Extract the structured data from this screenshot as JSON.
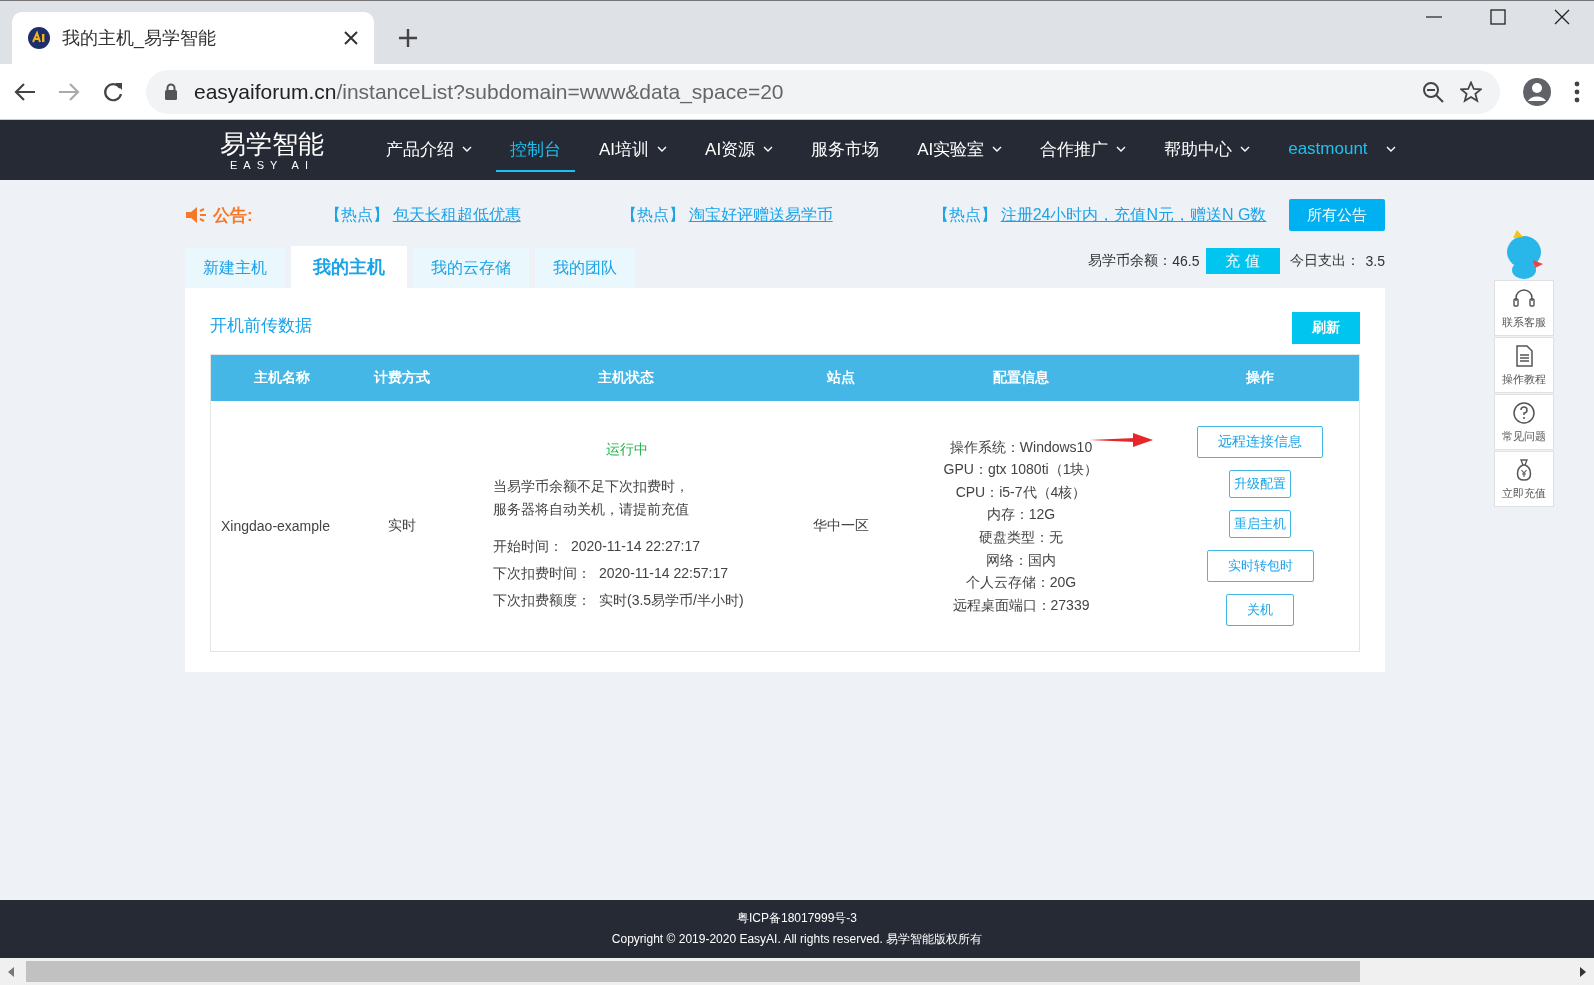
{
  "browser": {
    "tab_title": "我的主机_易学智能",
    "url_host": "easyaiforum.cn",
    "url_path": "/instanceList?subdomain=www&data_space=20"
  },
  "nav": {
    "logo": "易学智能",
    "logo_sub": "EASY AI",
    "items": [
      {
        "label": "产品介绍",
        "dropdown": true,
        "selected": false
      },
      {
        "label": "控制台",
        "dropdown": false,
        "selected": true
      },
      {
        "label": "AI培训",
        "dropdown": true,
        "selected": false
      },
      {
        "label": "AI资源",
        "dropdown": true,
        "selected": false
      },
      {
        "label": "服务市场",
        "dropdown": false,
        "selected": false
      },
      {
        "label": "AI实验室",
        "dropdown": true,
        "selected": false
      },
      {
        "label": "合作推广",
        "dropdown": true,
        "selected": false
      },
      {
        "label": "帮助中心",
        "dropdown": true,
        "selected": false
      }
    ],
    "user": "eastmount"
  },
  "notice": {
    "label": "公告:",
    "items": [
      {
        "tag": "【热点】",
        "link": "包天长租超低优惠"
      },
      {
        "tag": "【热点】",
        "link": "淘宝好评赠送易学币"
      },
      {
        "tag": "【热点】",
        "link": "注册24小时内，充值N元，赠送N G数"
      }
    ],
    "button": "所有公告"
  },
  "tabs": [
    {
      "label": "新建主机",
      "selected": false
    },
    {
      "label": "我的主机",
      "selected": true
    },
    {
      "label": "我的云存储",
      "selected": false
    },
    {
      "label": "我的团队",
      "selected": false
    }
  ],
  "balance": {
    "label": "易学币余额：",
    "value": "46.5",
    "button": "充 值",
    "spend_label": "今日支出：",
    "spend_value": "3.5"
  },
  "panel": {
    "title": "开机前传数据",
    "refresh": "刷新",
    "table": {
      "columns": [
        "主机名称",
        "计费方式",
        "主机状态",
        "站点",
        "配置信息",
        "操作"
      ],
      "rows": [
        {
          "name": "Xingdao-example",
          "billing": "实时",
          "status": {
            "kind": "running",
            "text": "运行中"
          },
          "note": [
            "当易学币余额不足下次扣费时，",
            "服务器将自动关机，请提前充值"
          ],
          "times": [
            {
              "label": "开始时间：",
              "value": "2020-11-14 22:27:17"
            },
            {
              "label": "下次扣费时间：",
              "value": "2020-11-14 22:57:17"
            },
            {
              "label": "下次扣费额度：",
              "value": "实时(3.5易学币/半小时)"
            }
          ],
          "site": "华中一区",
          "config": [
            "操作系统：Windows10",
            "GPU：gtx 1080ti（1块）",
            "CPU：i5-7代（4核）",
            "内存：12G",
            "硬盘类型：无",
            "网络：国内",
            "个人云存储：20G",
            "远程桌面端口：27339"
          ],
          "actions": [
            {
              "label": "远程连接信息",
              "kind": "wide"
            },
            {
              "label": "升级配置",
              "kind": "small"
            },
            {
              "label": "重启主机",
              "kind": "small"
            },
            {
              "label": "实时转包时",
              "kind": "medium"
            },
            {
              "label": "关机",
              "kind": "medium"
            }
          ]
        }
      ]
    }
  },
  "side_tools": [
    {
      "kind": "headset",
      "label": "联系客服"
    },
    {
      "kind": "document",
      "label": "操作教程"
    },
    {
      "kind": "question",
      "label": "常见问题"
    },
    {
      "kind": "moneybag",
      "label": "立即充值"
    }
  ],
  "footer": {
    "icp": "粤ICP备18017999号-3",
    "copyright": "Copyright © 2019-2020 EasyAI. All rights reserved. 易学智能版权所有"
  }
}
